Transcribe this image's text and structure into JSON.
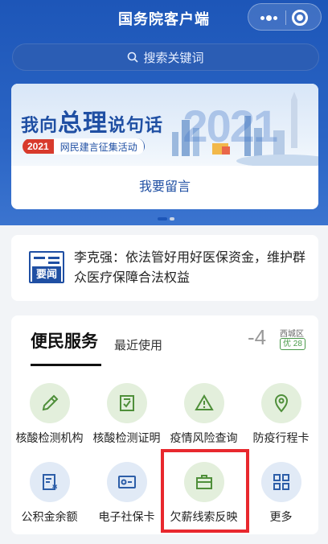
{
  "header": {
    "title": "国务院客户端"
  },
  "search": {
    "placeholder": "搜索关键词"
  },
  "banner": {
    "title_pre": "我向",
    "title_big": "总理",
    "title_post": "说句话",
    "year": "2021",
    "activity": "网民建言征集活动",
    "deco_number": "2021",
    "message_button": "我要留言"
  },
  "news": {
    "icon_label": "要闻",
    "headline": "李克强：依法管好用好医保资金，维护群众医疗保障合法权益"
  },
  "services": {
    "title": "便民服务",
    "recent_tab": "最近使用",
    "weather": {
      "temperature": "-4",
      "unit": "°",
      "district": "西城区",
      "aqi": "优 28"
    },
    "items": [
      {
        "label": "核酸检测机构",
        "icon": "dropper-icon"
      },
      {
        "label": "核酸检测证明",
        "icon": "certificate-icon"
      },
      {
        "label": "疫情风险查询",
        "icon": "warning-icon"
      },
      {
        "label": "防疫行程卡",
        "icon": "location-pin-icon"
      },
      {
        "label": "公积金余额",
        "icon": "fund-document-icon"
      },
      {
        "label": "电子社保卡",
        "icon": "social-security-card-icon"
      },
      {
        "label": "欠薪线索反映",
        "icon": "briefcase-icon"
      },
      {
        "label": "更多",
        "icon": "grid-more-icon"
      }
    ]
  },
  "colors": {
    "brand_blue": "#1d56b8",
    "icon_green_bg": "#e3efdc",
    "icon_green_fg": "#4f8f3a",
    "icon_blue_bg": "#e1eaf6",
    "icon_blue_fg": "#2d5ea8",
    "highlight_red": "#e8282e"
  }
}
